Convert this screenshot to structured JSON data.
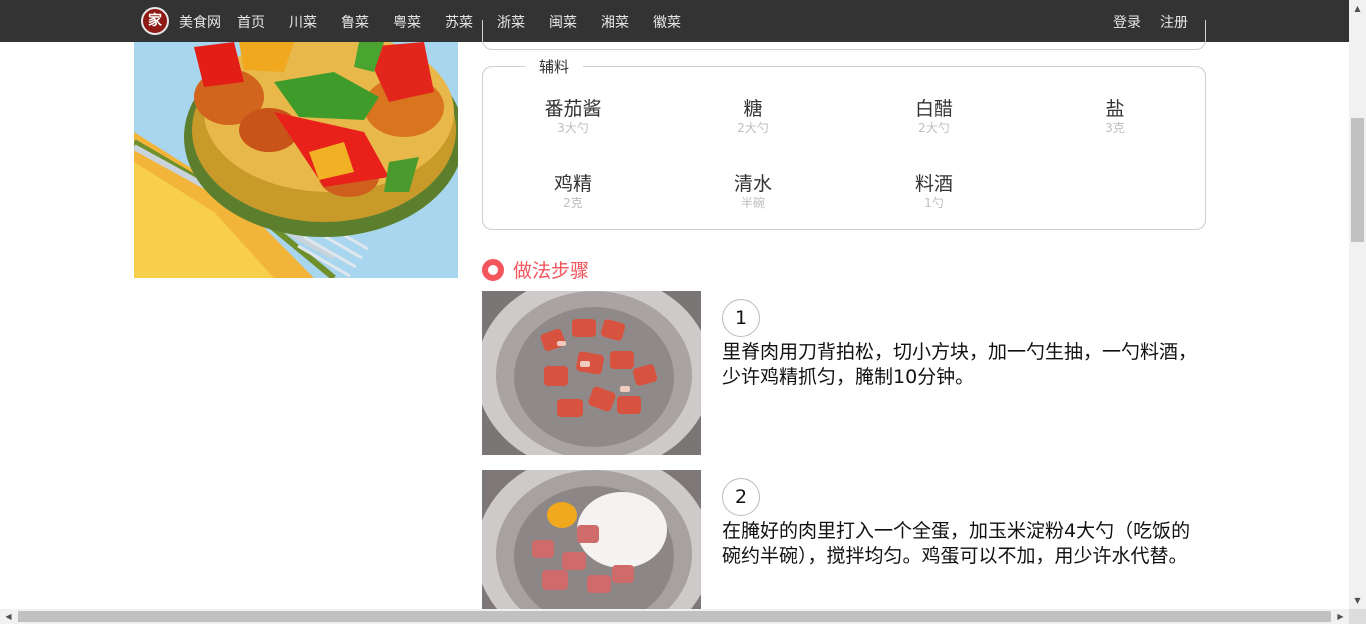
{
  "nav": {
    "logo_glyph": "家",
    "brand": "美食网",
    "items": [
      "首页",
      "川菜",
      "鲁菜",
      "粤菜",
      "苏菜",
      "浙菜",
      "闽菜",
      "湘菜",
      "徽菜"
    ],
    "login": "登录",
    "register": "注册"
  },
  "aux": {
    "legend": "辅料",
    "items": [
      {
        "name": "番茄酱",
        "amount": "3大勺"
      },
      {
        "name": "糖",
        "amount": "2大勺"
      },
      {
        "name": "白醋",
        "amount": "2大勺"
      },
      {
        "name": "盐",
        "amount": "3克"
      },
      {
        "name": "鸡精",
        "amount": "2克"
      },
      {
        "name": "清水",
        "amount": "半碗"
      },
      {
        "name": "料酒",
        "amount": "1勺"
      }
    ]
  },
  "steps": {
    "title": "做法步骤",
    "items": [
      {
        "num": "1",
        "text": "里脊肉用刀背拍松，切小方块，加一勺生抽，一勺料酒，少许鸡精抓匀，腌制10分钟。"
      },
      {
        "num": "2",
        "text": "在腌好的肉里打入一个全蛋，加玉米淀粉4大勺（吃饭的碗约半碗），搅拌均匀。鸡蛋可以不加，用少许水代替。"
      }
    ]
  },
  "colors": {
    "nav_bg": "#333333",
    "accent": "#f3565d"
  }
}
